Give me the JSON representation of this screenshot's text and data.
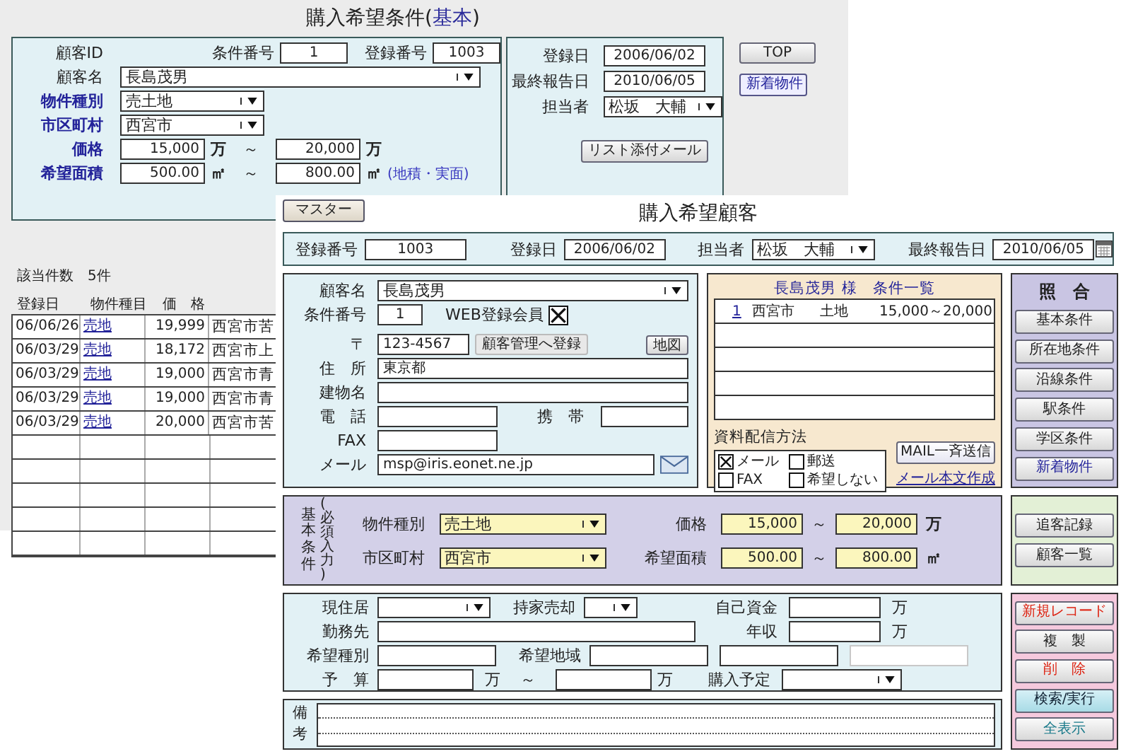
{
  "back_window": {
    "title_parts": [
      "購入希望条件(",
      "基本",
      ")"
    ],
    "customer_id_label": "顧客ID",
    "condition_no": {
      "label": "条件番号",
      "value": "1"
    },
    "reg_no": {
      "label": "登録番号",
      "value": "1003"
    },
    "customer_name": {
      "label": "顧客名",
      "value": "長島茂男"
    },
    "property_type": {
      "label": "物件種別",
      "value": "売土地"
    },
    "city": {
      "label": "市区町村",
      "value": "西宮市"
    },
    "price": {
      "label": "価格",
      "from": "15,000",
      "to": "20,000",
      "unit": "万",
      "tilde": "～",
      "unit2": "万"
    },
    "area": {
      "label": "希望面積",
      "from": "500.00",
      "to": "800.00",
      "unit": "㎡",
      "tilde": "～",
      "unit2": "㎡",
      "note": "(地積・実面)"
    },
    "dates": [
      {
        "label": "登録日",
        "value": "2006/06/02"
      },
      {
        "label": "最終報告日",
        "value": "2010/06/05"
      }
    ],
    "staff": {
      "label": "担当者",
      "value": "松坂　大輔"
    },
    "list_mail_button": "リスト添付メール",
    "top_button": "TOP",
    "new_button": "新着物件",
    "result_count": "該当件数　5件",
    "columns": [
      "登録日",
      "物件種目",
      "価　格"
    ],
    "rows": [
      {
        "date": "06/06/26",
        "type": "売地",
        "price": "19,999",
        "address": "西宮市苦"
      },
      {
        "date": "06/03/29",
        "type": "売地",
        "price": "18,172",
        "address": "西宮市上"
      },
      {
        "date": "06/03/29",
        "type": "売地",
        "price": "19,000",
        "address": "西宮市青"
      },
      {
        "date": "06/03/29",
        "type": "売地",
        "price": "19,000",
        "address": "西宮市青"
      },
      {
        "date": "06/03/29",
        "type": "売地",
        "price": "20,000",
        "address": "西宮市苦"
      }
    ]
  },
  "front_window": {
    "master_button": "マスター",
    "title": "購入希望顧客",
    "header": {
      "reg_no": {
        "label": "登録番号",
        "value": "1003"
      },
      "reg_date": {
        "label": "登録日",
        "value": "2006/06/02"
      },
      "staff": {
        "label": "担当者",
        "value": "松坂　大輔"
      },
      "last_report": {
        "label": "最終報告日",
        "value": "2010/06/05"
      }
    },
    "customer": {
      "name": {
        "label": "顧客名",
        "value": "長島茂男"
      },
      "condition_no": {
        "label": "条件番号",
        "value": "1"
      },
      "web_member": {
        "label": "WEB登録会員",
        "checked": true
      },
      "postal": {
        "label": "〒",
        "value": "123-4567"
      },
      "register_button": "顧客管理へ登録",
      "map_button": "地図",
      "address": {
        "label": "住　所",
        "value": "東京都"
      },
      "building": {
        "label": "建物名"
      },
      "phone": {
        "label": "電　話"
      },
      "mobile": {
        "label": "携　帯"
      },
      "fax": {
        "label": "FAX"
      },
      "mail": {
        "label": "メール",
        "value": "msp@iris.eonet.ne.jp"
      }
    },
    "conditions": {
      "name": "長島茂男",
      "title": "様　条件一覧",
      "rows": [
        {
          "no": "1",
          "city": "西宮市",
          "type": "土地",
          "price": "15,000～20,000"
        }
      ],
      "delivery_title": "資料配信方法",
      "delivery": [
        {
          "label": "メール",
          "checked": true
        },
        {
          "label": "郵送",
          "checked": false
        },
        {
          "label": "FAX",
          "checked": false
        },
        {
          "label": "希望しない",
          "checked": false
        }
      ],
      "mail_button": "MAIL一斉送信",
      "mail_link": "メール本文作成"
    },
    "match": {
      "title": "照　合",
      "buttons": [
        "基本条件",
        "所在地条件",
        "沿線条件",
        "駅条件",
        "学区条件",
        "新着物件"
      ]
    },
    "basic": {
      "label": "基本条件",
      "sub": "(必須入力)",
      "property_type": {
        "label": "物件種別",
        "value": "売土地"
      },
      "city": {
        "label": "市区町村",
        "value": "西宮市"
      },
      "price": {
        "label": "価格",
        "from": "15,000",
        "to": "20,000",
        "unit": "万",
        "tilde": "～"
      },
      "area": {
        "label": "希望面積",
        "from": "500.00",
        "to": "800.00",
        "unit": "㎡",
        "tilde": "～"
      }
    },
    "side_buttons": [
      "追客記録",
      "顧客一覧"
    ],
    "details": {
      "current_home": {
        "label": "現住居"
      },
      "sell_home": {
        "label": "持家売却"
      },
      "own_funds": {
        "label": "自己資金",
        "unit": "万"
      },
      "workplace": {
        "label": "勤務先"
      },
      "income": {
        "label": "年収",
        "unit": "万"
      },
      "desired_type": {
        "label": "希望種別"
      },
      "desired_area": {
        "label": "希望地域"
      },
      "budget": {
        "label": "予　算",
        "unit": "万",
        "tilde": "～",
        "unit2": "万"
      },
      "purchase_plan": {
        "label": "購入予定"
      }
    },
    "remarks_label": "備考",
    "actions": [
      {
        "label": "新規レコード",
        "kind": "new"
      },
      {
        "label": "複　製",
        "kind": "plain"
      },
      {
        "label": "削　除",
        "kind": "danger"
      },
      {
        "label": "検索/実行",
        "kind": "search"
      },
      {
        "label": "全表示",
        "kind": "show"
      }
    ]
  }
}
